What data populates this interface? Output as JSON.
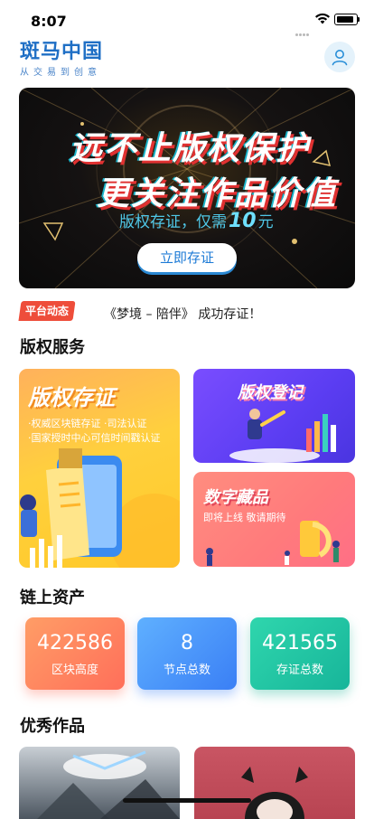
{
  "status_bar": {
    "time": "8:07"
  },
  "header": {
    "brand": "斑马中国",
    "tagline": "从交易到创意"
  },
  "banner": {
    "headline_1": "远不止版权保护",
    "headline_2": "更关注作品价值",
    "price_prefix": "版权存证，仅需",
    "price_value": "10",
    "price_unit": "元",
    "cta_label": "立即存证"
  },
  "news": {
    "tag": "平台动态",
    "message": "《梦境 – 陪伴》 成功存证！"
  },
  "services": {
    "title": "版权服务",
    "cunzheng": {
      "title": "版权存证",
      "line_1": "·权威区块链存证  ·司法认证",
      "line_2": "·国家授时中心可信时间戳认证"
    },
    "dengji": {
      "title": "版权登记"
    },
    "cangpin": {
      "title": "数字藏品",
      "subtitle": "即将上线 敬请期待"
    }
  },
  "assets": {
    "title": "链上资产",
    "stats": [
      {
        "value": "422586",
        "label": "区块高度"
      },
      {
        "value": "8",
        "label": "节点总数"
      },
      {
        "value": "421565",
        "label": "存证总数"
      }
    ]
  },
  "works": {
    "title": "优秀作品"
  }
}
